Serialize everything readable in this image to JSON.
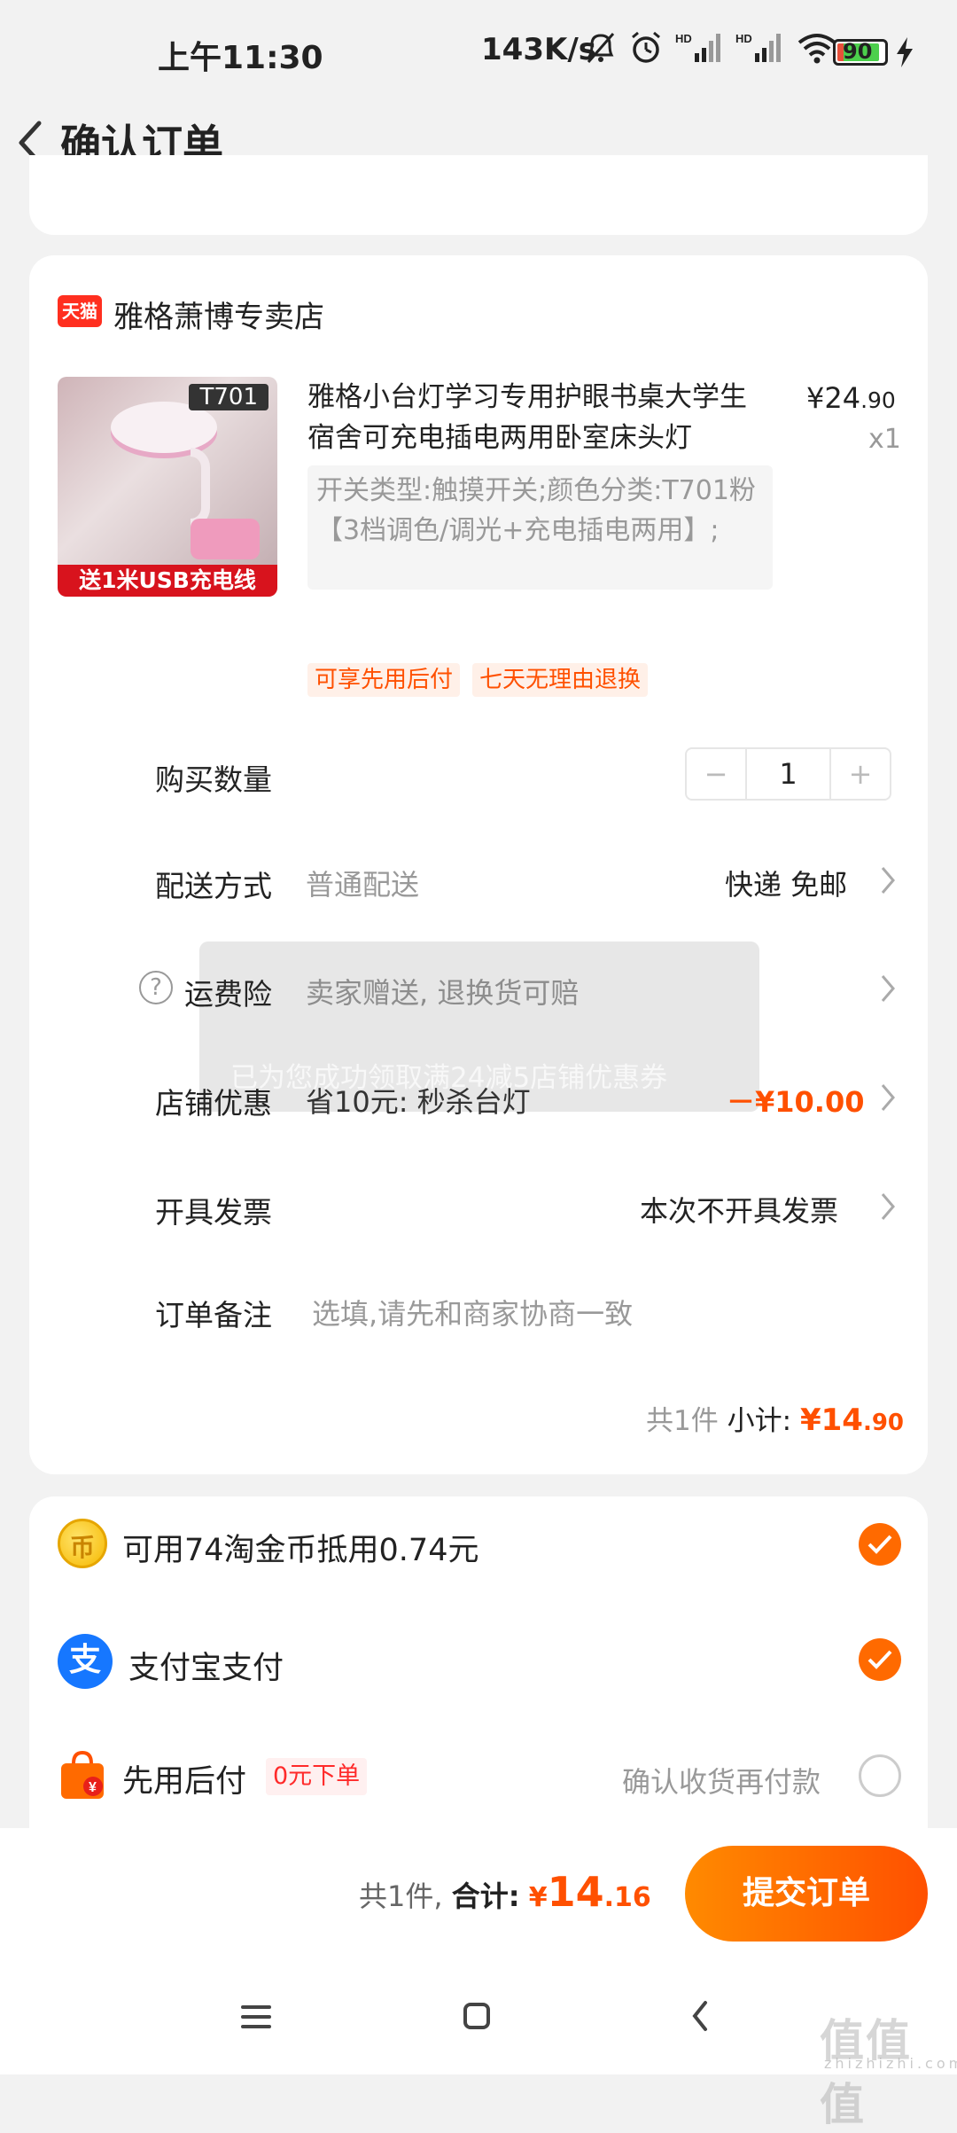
{
  "status_bar": {
    "time": "上午11:30",
    "net_speed": "143K/s",
    "battery": "90",
    "battery_level": 0.9,
    "icons": [
      "mute-icon",
      "alarm-icon",
      "hd-signal-icon",
      "hd-signal-icon",
      "wifi-icon",
      "battery-icon",
      "charging-icon"
    ]
  },
  "header": {
    "title": "确认订单"
  },
  "store": {
    "logo_text": "天猫",
    "name": "雅格萧博专卖店"
  },
  "product": {
    "image_badge": "T701",
    "image_strip": "送1米USB充电线",
    "title": "雅格小台灯学习专用护眼书桌大学生宿舍可充电插电两用卧室床头灯",
    "price_main": "24",
    "price_decimal": ".90",
    "price_symbol": "¥",
    "quantity_label": "x1",
    "sku": "开关类型:触摸开关;颜色分类:T701粉【3档调色/调光+充电插电两用】;"
  },
  "tags": [
    "可享先用后付",
    "七天无理由退换"
  ],
  "rows": {
    "quantity": {
      "label": "购买数量",
      "minus": "−",
      "value": "1",
      "plus": "+"
    },
    "delivery": {
      "label": "配送方式",
      "value": "普通配送",
      "right": "快递 免邮"
    },
    "insurance": {
      "label": "运费险",
      "value": "卖家赠送, 退换货可赔",
      "help": "?"
    },
    "coupon": {
      "label": "店铺优惠",
      "value": "省10元: 秒杀台灯",
      "right": "－¥10.00"
    },
    "invoice": {
      "label": "开具发票",
      "right": "本次不开具发票"
    },
    "note": {
      "label": "订单备注",
      "placeholder": "选填,请先和商家协商一致"
    }
  },
  "toast": {
    "text": "已为您成功领取满24减5店铺优惠券"
  },
  "subtotal": {
    "count": "共1件",
    "label": "小计:",
    "symbol": "¥",
    "main": "14",
    "decimal": ".90"
  },
  "payment": {
    "coins": {
      "label": "可用74淘金币抵用0.74元",
      "icon_text": "币"
    },
    "alipay": {
      "label": "支付宝支付",
      "icon_text": "支"
    },
    "later": {
      "label": "先用后付",
      "tag": "0元下单",
      "right": "确认收货再付款"
    }
  },
  "bottom": {
    "count": "共1件,",
    "label": "合计:",
    "symbol": "¥",
    "main": "14",
    "decimal": ".16",
    "submit": "提交订单"
  },
  "watermark": {
    "big": "值值值",
    "small": "zhizhizhi.com"
  },
  "colors": {
    "accent": "#ff5000",
    "alipay": "#1677ff",
    "tmall": "#ff2f1f"
  }
}
